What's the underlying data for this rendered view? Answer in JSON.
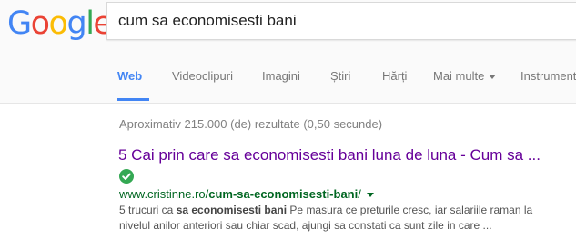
{
  "logo": {
    "letters": [
      {
        "char": "G",
        "color": "#4285F4"
      },
      {
        "char": "o",
        "color": "#EA4335"
      },
      {
        "char": "o",
        "color": "#FBBC05"
      },
      {
        "char": "g",
        "color": "#4285F4"
      },
      {
        "char": "l",
        "color": "#34A853"
      },
      {
        "char": "e",
        "color": "#EA4335"
      }
    ]
  },
  "search": {
    "value": "cum sa economisesti bani"
  },
  "tabs": [
    {
      "label": "Web",
      "active": true
    },
    {
      "label": "Videoclipuri",
      "active": false
    },
    {
      "label": "Imagini",
      "active": false
    },
    {
      "label": "Știri",
      "active": false
    },
    {
      "label": "Hărți",
      "active": false
    },
    {
      "label": "Mai multe",
      "active": false,
      "icon": "chevron-down-icon"
    },
    {
      "label": "Instrument",
      "active": false
    }
  ],
  "results_stats": "Aproximativ 215.000 (de) rezultate (0,50 secunde)",
  "result": {
    "title": "5 Cai prin care sa economisesti bani luna de luna - Cum sa ...",
    "verified_icon": "check-circle-icon",
    "url_prefix": "www.cristinne.ro/",
    "url_bold": "cum-sa-economisesti-bani",
    "url_suffix": "/",
    "snippet_line1_pre": "5 trucuri ca ",
    "snippet_line1_bold": "sa economisesti bani",
    "snippet_line1_post": " Pe masura ce preturile cresc, iar salariile raman la",
    "snippet_line2": "nivelul anilor anteriori sau chiar scad, ajungi sa constati ca sunt zile in care ..."
  },
  "colors": {
    "link_visited": "#660099",
    "url_green": "#006621",
    "active_tab": "#4285F4",
    "verified_green": "#34A853"
  }
}
